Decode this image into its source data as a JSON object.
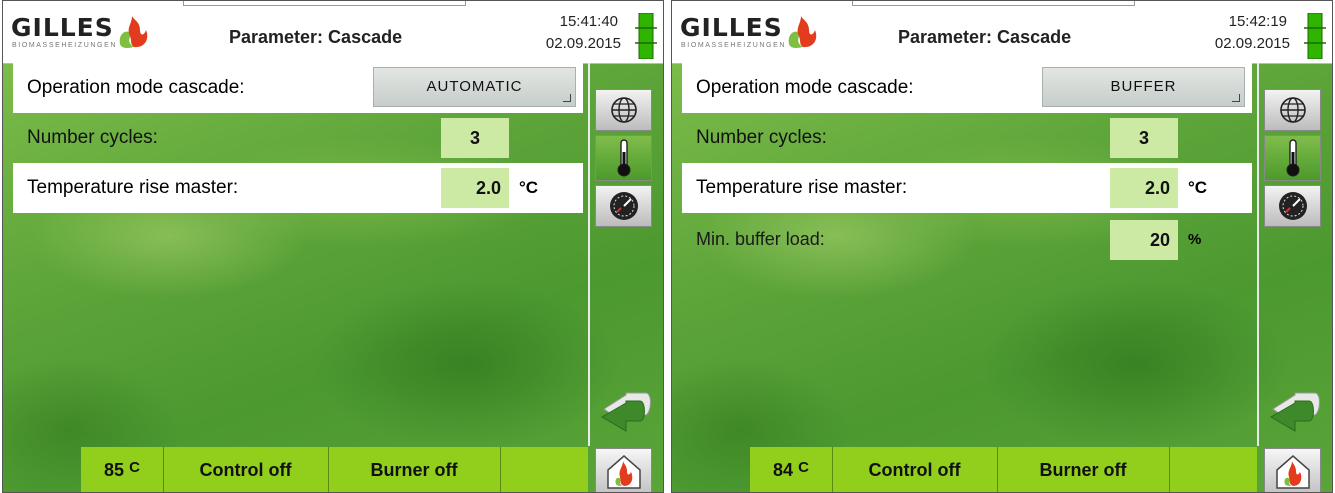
{
  "panels": [
    {
      "logo_text": "GILLES",
      "logo_subtext": "BIOMASSEHEIZUNGEN",
      "title": "Parameter: Cascade",
      "time": "15:41:40",
      "date": "02.09.2015",
      "operation_mode_label": "Operation mode cascade:",
      "operation_mode_value": "AUTOMATIC",
      "number_cycles_label": "Number cycles:",
      "number_cycles_value": "3",
      "temp_rise_label": "Temperature rise master:",
      "temp_rise_value": "2.0",
      "temp_rise_unit": "°C",
      "bottom_temp_value": "85",
      "bottom_temp_unit": "C",
      "control_status": "Control off",
      "burner_status": "Burner off"
    },
    {
      "logo_text": "GILLES",
      "logo_subtext": "BIOMASSEHEIZUNGEN",
      "title": "Parameter: Cascade",
      "time": "15:42:19",
      "date": "02.09.2015",
      "operation_mode_label": "Operation mode cascade:",
      "operation_mode_value": "BUFFER",
      "number_cycles_label": "Number cycles:",
      "number_cycles_value": "3",
      "temp_rise_label": "Temperature rise master:",
      "temp_rise_value": "2.0",
      "temp_rise_unit": "°C",
      "min_buffer_label": "Min. buffer load:",
      "min_buffer_value": "20",
      "min_buffer_unit": "%",
      "bottom_temp_value": "84",
      "bottom_temp_unit": "C",
      "control_status": "Control off",
      "burner_status": "Burner off"
    }
  ],
  "icons": {
    "language": "globe-icon",
    "temperature": "thermometer-icon",
    "service": "gauge-icon",
    "back": "back-arrow-icon",
    "home": "home-flame-icon",
    "battery": "battery-icon",
    "logo": "flame-logo-icon"
  },
  "colors": {
    "status_bar": "#92cf1d",
    "value_box": "#cdeaa5",
    "battery": "#2fb400",
    "logo_flame": "#e23b1e",
    "logo_leaf": "#7fbf3f"
  }
}
